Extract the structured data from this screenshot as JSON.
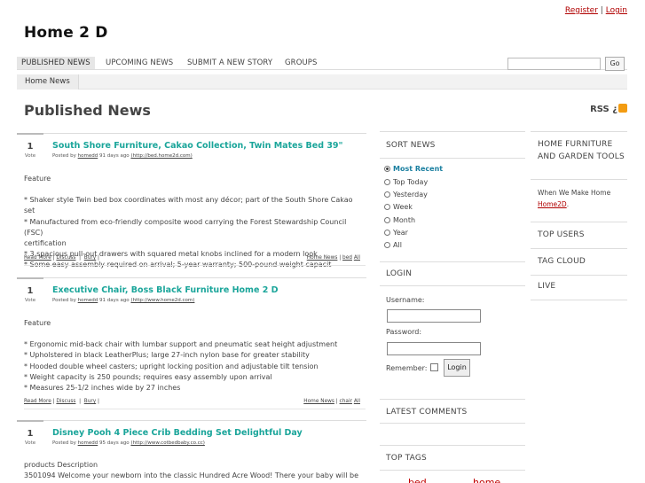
{
  "header": {
    "register": "Register",
    "separator": "|",
    "login": "Login",
    "site_title": "Home 2 D"
  },
  "nav": {
    "items": [
      "PUBLISHED NEWS",
      "UPCOMING NEWS",
      "SUBMIT A NEW STORY",
      "GROUPS"
    ],
    "active": "PUBLISHED NEWS",
    "search_value": "",
    "go": "Go"
  },
  "breadcrumb": {
    "item": "Home News"
  },
  "page": {
    "title": "Published News",
    "rss": "RSS ¿"
  },
  "stories": [
    {
      "votes": "1",
      "vote_label": "Vote",
      "title": "South Shore Furniture, Cakao Collection, Twin Mates Bed 39\"",
      "meta_prefix": "Posted by",
      "author": "homedd",
      "age": "91 days ago",
      "url": "(http://bed.home2d.com)",
      "label": "Feature",
      "lines": [
        "* Shaker style Twin bed box coordinates with most any décor; part of the South Shore Cakao set",
        "* Manufactured from eco-friendly composite wood carrying the Forest Stewardship Council (FSC)",
        "certification",
        "* 3 spacious pull-out drawers with squared metal knobs inclined for a modern look",
        "* Some easy assembly required on arrival; 5-year warranty; 500-pound weight capacit"
      ],
      "actions": [
        "Read More",
        "Discuss",
        "Bury"
      ],
      "category": "Home News",
      "tags": [
        "bed",
        "All"
      ]
    },
    {
      "votes": "1",
      "vote_label": "Vote",
      "title": "Executive Chair, Boss Black Furniture Home 2 D",
      "meta_prefix": "Posted by",
      "author": "homedd",
      "age": "91 days ago",
      "url": "(http://www.home2d.com)",
      "label": "Feature",
      "lines": [
        "* Ergonomic mid-back chair with lumbar support and pneumatic seat height adjustment",
        "* Upholstered in black LeatherPlus; large 27-inch nylon base for greater stability",
        "* Hooded double wheel casters; upright locking position and adjustable tilt tension",
        "* Weight capacity is 250 pounds; requires easy assembly upon arrival",
        "* Measures 25-1/2 inches wide by 27 inches"
      ],
      "actions": [
        "Read More",
        "Discuss",
        "Bury"
      ],
      "category": "Home News",
      "tags": [
        "chair",
        "All"
      ]
    },
    {
      "votes": "1",
      "vote_label": "Vote",
      "title": "Disney Pooh 4 Piece Crib Bedding Set Delightful Day",
      "meta_prefix": "Posted by",
      "author": "homedd",
      "age": "95 days ago",
      "url": "(http://www.cotbedbaby.co.cc)",
      "label": "products Description",
      "lines": [
        "3501094 Welcome your newborn into the classic Hundred Acre Wood! There your baby will be"
      ]
    }
  ],
  "sort": {
    "heading": "SORT NEWS",
    "options": [
      "Most Recent",
      "Top Today",
      "Yesterday",
      "Week",
      "Month",
      "Year",
      "All"
    ],
    "selected": "Most Recent"
  },
  "login": {
    "heading": "LOGIN",
    "username_label": "Username:",
    "username_value": "",
    "password_label": "Password:",
    "password_value": "",
    "remember_label": "Remember:",
    "button": "Login"
  },
  "latest_comments": {
    "heading": "LATEST COMMENTS"
  },
  "top_tags": {
    "heading": "TOP TAGS",
    "peek": [
      "bed",
      "home"
    ]
  },
  "right": {
    "heading1": "HOME FURNITURE AND GARDEN TOOLS",
    "text1": "When We Make Home",
    "link1": "Home2D",
    "link1_suffix": ".",
    "heading2": "TOP USERS",
    "heading3": "TAG CLOUD",
    "heading4": "LIVE"
  },
  "colors": {
    "accent": "#1aa59a",
    "link_red": "#b00000",
    "sort_active": "#1a7fa0"
  }
}
